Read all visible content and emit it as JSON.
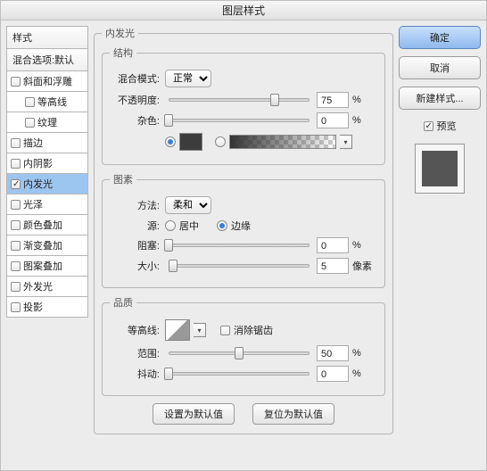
{
  "dialog_title": "图层样式",
  "sidebar": {
    "head_styles": "样式",
    "head_blend": "混合选项:默认",
    "items": [
      {
        "label": "斜面和浮雕",
        "checked": false,
        "indent": false
      },
      {
        "label": "等高线",
        "checked": false,
        "indent": true
      },
      {
        "label": "纹理",
        "checked": false,
        "indent": true
      },
      {
        "label": "描边",
        "checked": false,
        "indent": false
      },
      {
        "label": "内阴影",
        "checked": false,
        "indent": false
      },
      {
        "label": "内发光",
        "checked": true,
        "indent": false,
        "selected": true
      },
      {
        "label": "光泽",
        "checked": false,
        "indent": false
      },
      {
        "label": "颜色叠加",
        "checked": false,
        "indent": false
      },
      {
        "label": "渐变叠加",
        "checked": false,
        "indent": false
      },
      {
        "label": "图案叠加",
        "checked": false,
        "indent": false
      },
      {
        "label": "外发光",
        "checked": false,
        "indent": false
      },
      {
        "label": "投影",
        "checked": false,
        "indent": false
      }
    ]
  },
  "panel": {
    "title": "内发光",
    "structure": {
      "legend": "结构",
      "blend_mode_label": "混合模式:",
      "blend_mode_value": "正常",
      "opacity_label": "不透明度:",
      "opacity_value": "75",
      "opacity_unit": "%",
      "noise_label": "杂色:",
      "noise_value": "0",
      "noise_unit": "%",
      "color_src_color": true,
      "color_src_gradient": false,
      "swatch_color": "#3c3c3c"
    },
    "elements": {
      "legend": "图素",
      "technique_label": "方法:",
      "technique_value": "柔和",
      "source_label": "源:",
      "source_center": "居中",
      "source_edge": "边缘",
      "source_selected": "edge",
      "choke_label": "阻塞:",
      "choke_value": "0",
      "choke_unit": "%",
      "size_label": "大小:",
      "size_value": "5",
      "size_unit": "像素"
    },
    "quality": {
      "legend": "品质",
      "contour_label": "等高线:",
      "antialias_label": "消除锯齿",
      "range_label": "范围:",
      "range_value": "50",
      "range_unit": "%",
      "jitter_label": "抖动:",
      "jitter_value": "0",
      "jitter_unit": "%"
    },
    "set_default": "设置为默认值",
    "reset_default": "复位为默认值"
  },
  "right": {
    "ok": "确定",
    "cancel": "取消",
    "new_style": "新建样式...",
    "preview_label": "预览",
    "preview_checked": true
  }
}
